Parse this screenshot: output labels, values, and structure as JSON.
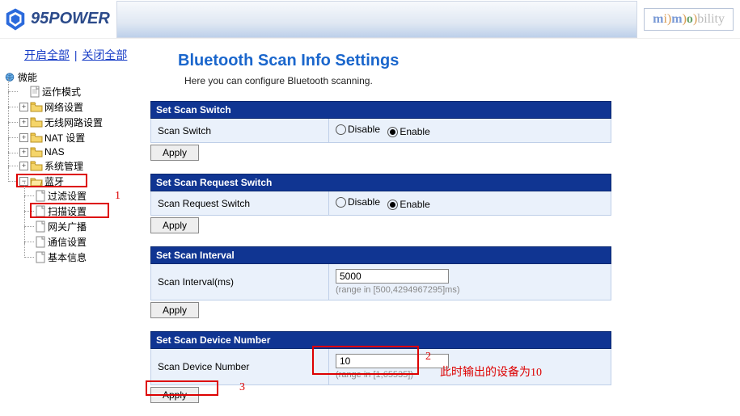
{
  "brand": {
    "name": "95POWER"
  },
  "mimo": {
    "text": "mi)m)o)bility"
  },
  "top_links": {
    "open_all": "开启全部",
    "close_all": "关闭全部"
  },
  "tree": {
    "root": "微能",
    "mode": "运作模式",
    "net": "网络设置",
    "wlan": "无线网路设置",
    "nat": "NAT 设置",
    "nas": "NAS",
    "sys": "系统管理",
    "bt": "蓝牙",
    "bt_children": {
      "filter": "过滤设置",
      "scan": "扫描设置",
      "gw": "网关广播",
      "comm": "通信设置",
      "basic": "基本信息"
    }
  },
  "page": {
    "title": "Bluetooth Scan Info Settings",
    "subtitle": "Here you can configure Bluetooth scanning."
  },
  "sections": {
    "switch": {
      "title": "Set Scan Switch",
      "label": "Scan Switch",
      "disable": "Disable",
      "enable": "Enable",
      "apply": "Apply"
    },
    "req": {
      "title": "Set Scan Request Switch",
      "label": "Scan Request Switch",
      "disable": "Disable",
      "enable": "Enable",
      "apply": "Apply"
    },
    "interval": {
      "title": "Set Scan Interval",
      "label": "Scan Interval(ms)",
      "value": "5000",
      "hint": "(range in [500,4294967295]ms)",
      "apply": "Apply"
    },
    "devnum": {
      "title": "Set Scan Device Number",
      "label": "Scan Device Number",
      "value": "10",
      "hint": "(range in [1,65535])",
      "apply": "Apply"
    }
  },
  "annotations": {
    "n1": "1",
    "n2": "2",
    "n3": "3",
    "note": "此时输出的设备为10"
  }
}
